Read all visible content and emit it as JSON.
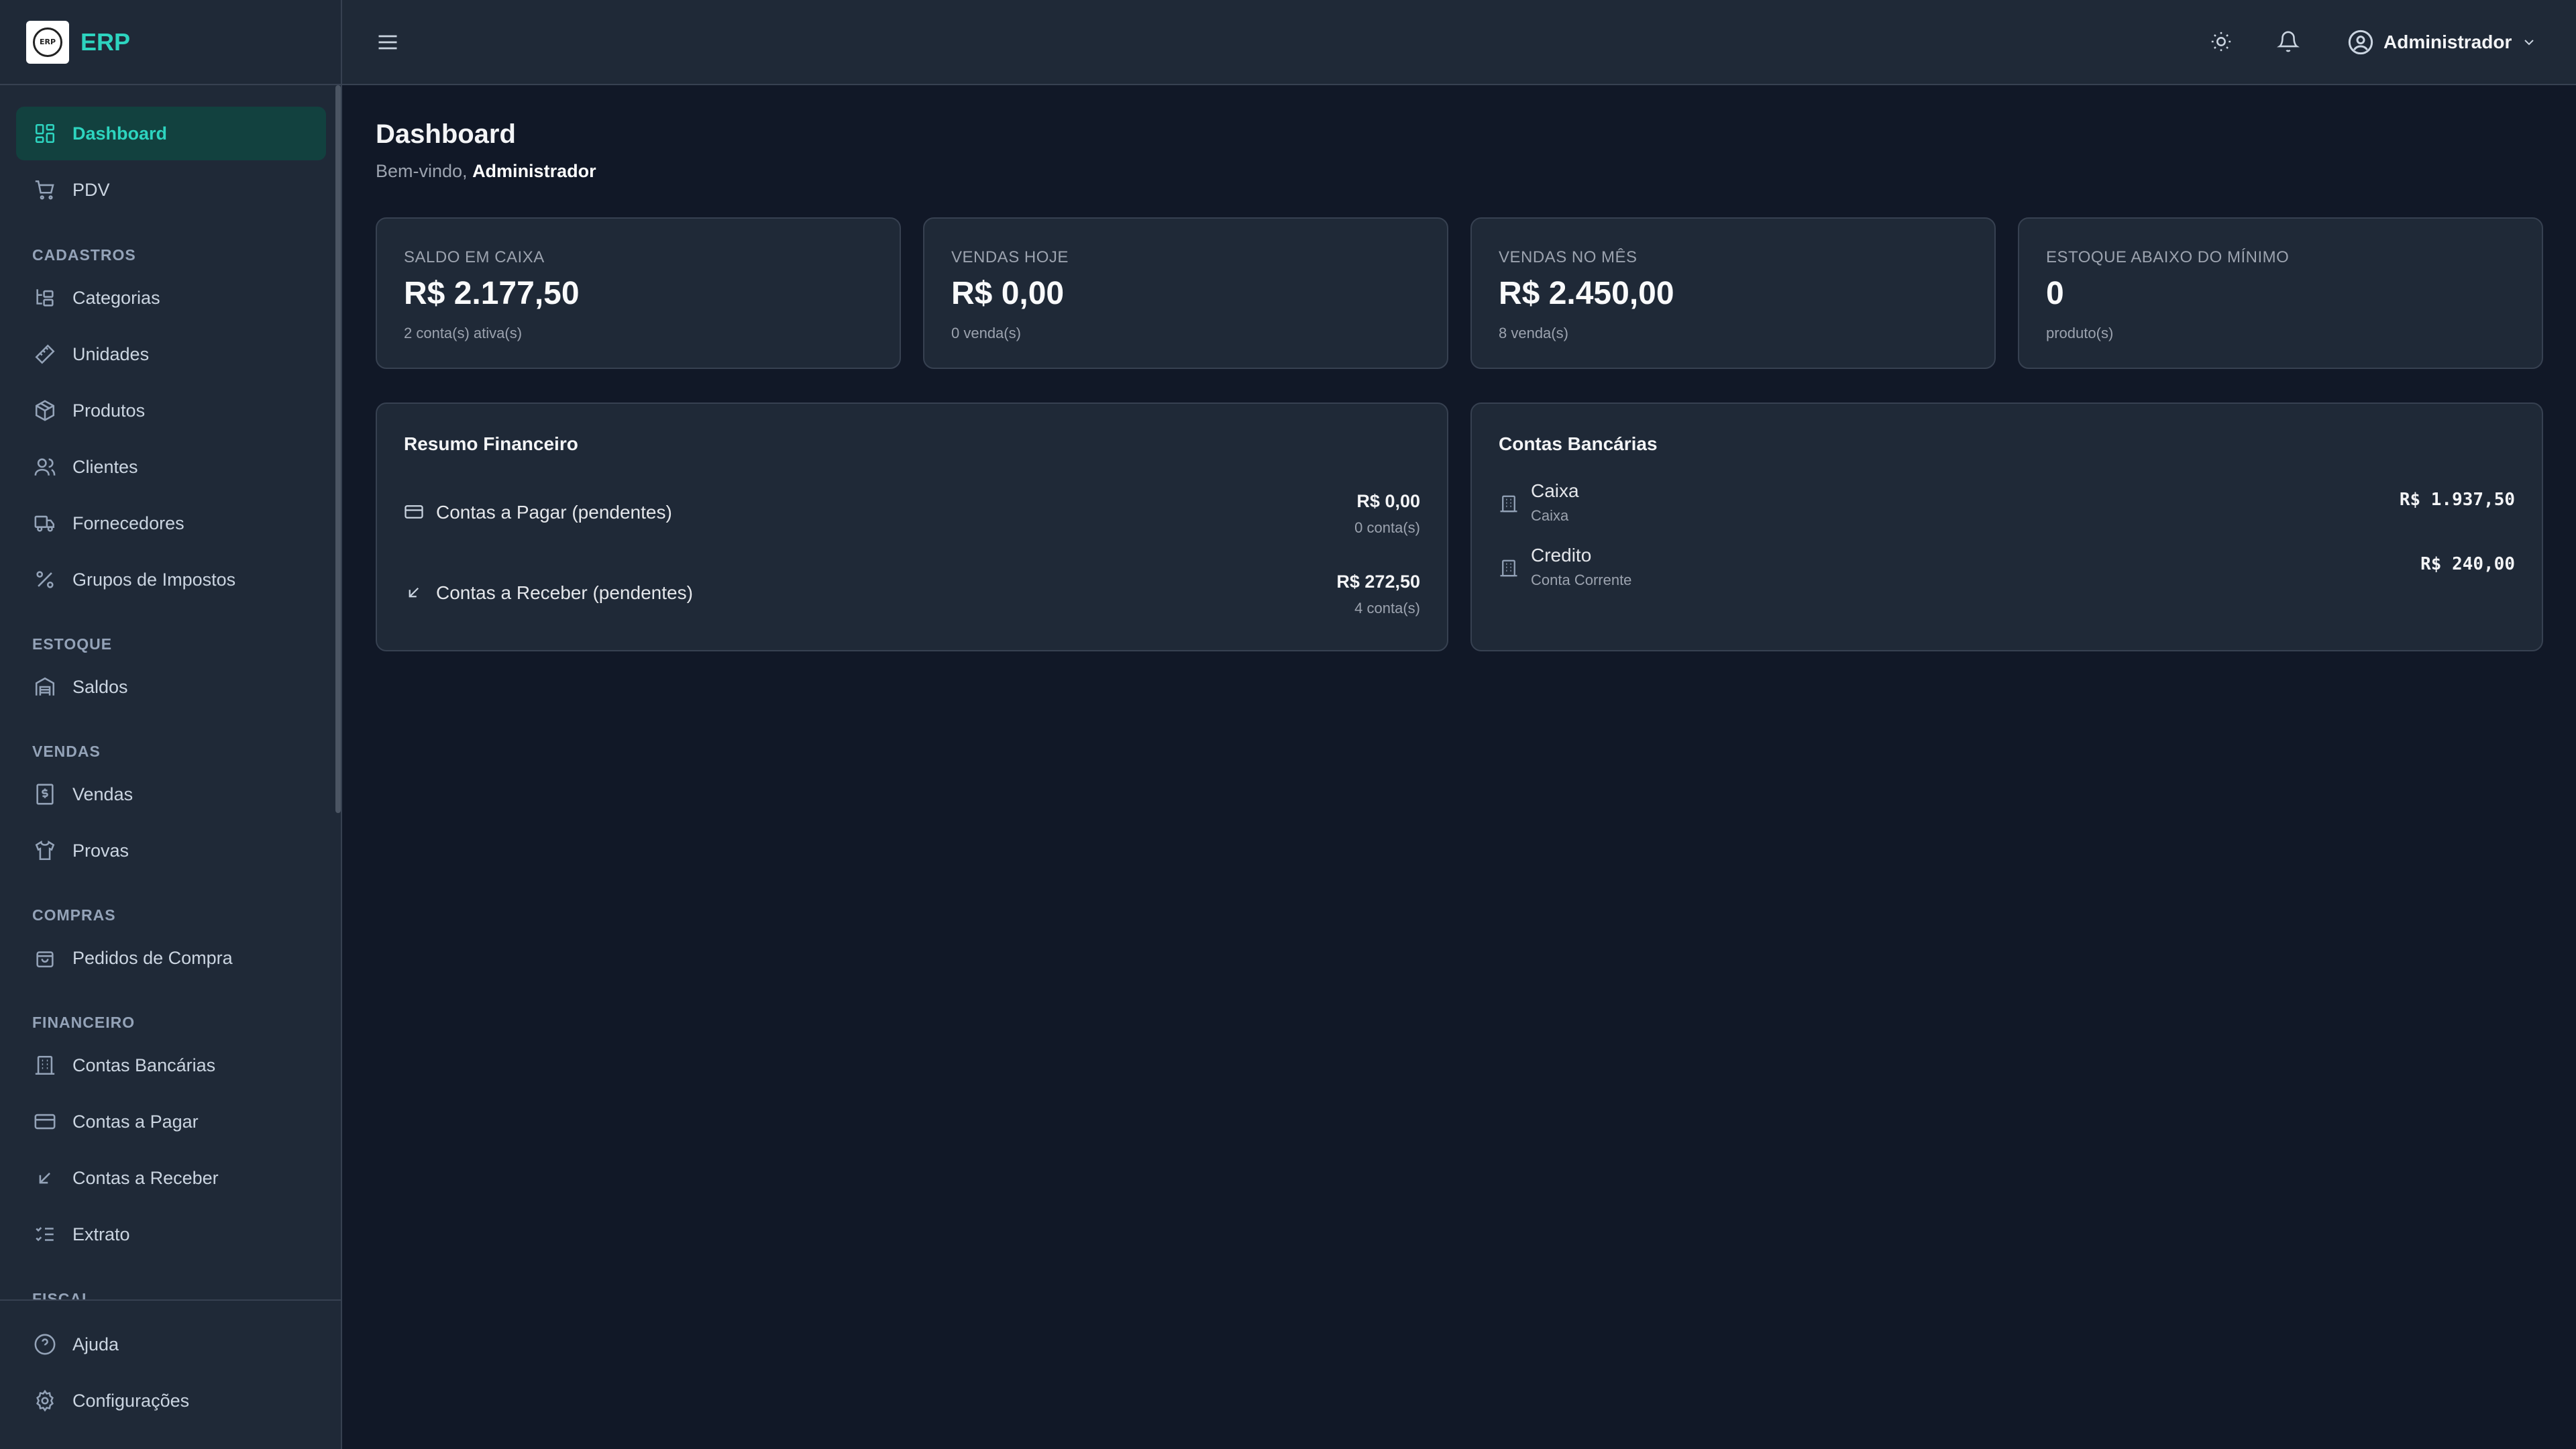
{
  "brand": {
    "logo_text": "ERP",
    "name": "ERP"
  },
  "sidebar": {
    "items": [
      {
        "label": "Dashboard",
        "icon": "dashboard-icon"
      },
      {
        "label": "PDV",
        "icon": "cart-icon"
      }
    ],
    "sections": [
      {
        "title": "CADASTROS",
        "items": [
          {
            "label": "Categorias",
            "icon": "folder-tree-icon"
          },
          {
            "label": "Unidades",
            "icon": "ruler-icon"
          },
          {
            "label": "Produtos",
            "icon": "package-icon"
          },
          {
            "label": "Clientes",
            "icon": "users-icon"
          },
          {
            "label": "Fornecedores",
            "icon": "truck-icon"
          },
          {
            "label": "Grupos de Impostos",
            "icon": "percent-icon"
          }
        ]
      },
      {
        "title": "ESTOQUE",
        "items": [
          {
            "label": "Saldos",
            "icon": "warehouse-icon"
          }
        ]
      },
      {
        "title": "VENDAS",
        "items": [
          {
            "label": "Vendas",
            "icon": "receipt-icon"
          },
          {
            "label": "Provas",
            "icon": "shirt-icon"
          }
        ]
      },
      {
        "title": "COMPRAS",
        "items": [
          {
            "label": "Pedidos de Compra",
            "icon": "shopping-bag-icon"
          }
        ]
      },
      {
        "title": "FINANCEIRO",
        "items": [
          {
            "label": "Contas Bancárias",
            "icon": "bank-icon"
          },
          {
            "label": "Contas a Pagar",
            "icon": "credit-card-icon"
          },
          {
            "label": "Contas a Receber",
            "icon": "arrow-down-left-icon"
          },
          {
            "label": "Extrato",
            "icon": "list-checks-icon"
          }
        ]
      },
      {
        "title": "FISCAL",
        "items": []
      }
    ],
    "bottom": [
      {
        "label": "Ajuda",
        "icon": "help-circle-icon"
      },
      {
        "label": "Configurações",
        "icon": "settings-icon"
      }
    ]
  },
  "header": {
    "user_name": "Administrador"
  },
  "page": {
    "title": "Dashboard",
    "welcome_prefix": "Bem-vindo, ",
    "welcome_user": "Administrador"
  },
  "stats": [
    {
      "label": "SALDO EM CAIXA",
      "value": "R$ 2.177,50",
      "sub": "2 conta(s) ativa(s)"
    },
    {
      "label": "VENDAS HOJE",
      "value": "R$ 0,00",
      "sub": "0 venda(s)"
    },
    {
      "label": "VENDAS NO MÊS",
      "value": "R$ 2.450,00",
      "sub": "8 venda(s)"
    },
    {
      "label": "ESTOQUE ABAIXO DO MÍNIMO",
      "value": "0",
      "sub": "produto(s)"
    }
  ],
  "financial_summary": {
    "title": "Resumo Financeiro",
    "rows": [
      {
        "label": "Contas a Pagar (pendentes)",
        "amount": "R$ 0,00",
        "count": "0 conta(s)",
        "icon": "credit-card-icon"
      },
      {
        "label": "Contas a Receber (pendentes)",
        "amount": "R$ 272,50",
        "count": "4 conta(s)",
        "icon": "arrow-down-left-icon"
      }
    ]
  },
  "bank_accounts": {
    "title": "Contas Bancárias",
    "rows": [
      {
        "name": "Caixa",
        "type": "Caixa",
        "amount": "R$ 1.937,50",
        "icon": "bank-icon"
      },
      {
        "name": "Credito",
        "type": "Conta Corrente",
        "amount": "R$ 240,00",
        "icon": "bank-icon"
      }
    ]
  },
  "colors": {
    "background": "#111827",
    "surface": "#1f2937",
    "border": "#374151",
    "accent": "#2dd4bf",
    "active_bg": "#12413f"
  }
}
